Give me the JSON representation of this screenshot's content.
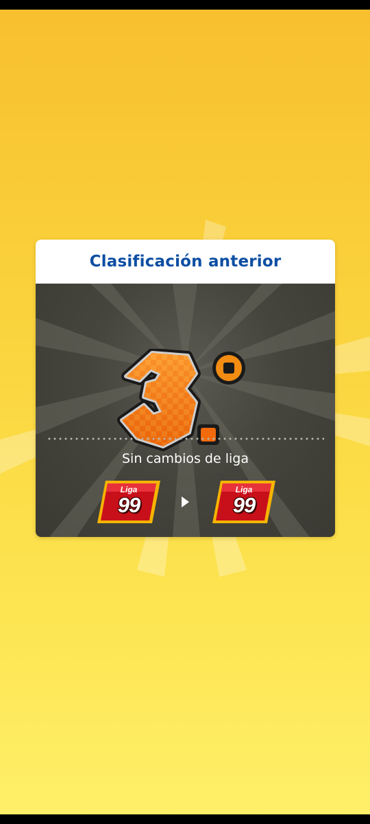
{
  "panel": {
    "title": "Clasificación anterior",
    "rank_value": "3",
    "rank_suffix": "°",
    "status_text": "Sin cambios de liga",
    "league_from": {
      "label": "Liga",
      "number": "99"
    },
    "league_to": {
      "label": "Liga",
      "number": "99"
    }
  },
  "colors": {
    "background_top": "#f8bf2e",
    "background_bottom": "#fff06a",
    "title_blue": "#0d4ea3",
    "panel_dark": "#45453d",
    "rank_orange": "#f26a0c",
    "badge_red": "#c8101a",
    "badge_gold": "#f5b400"
  },
  "icons": {
    "transition_arrow": "play-arrow-icon"
  }
}
